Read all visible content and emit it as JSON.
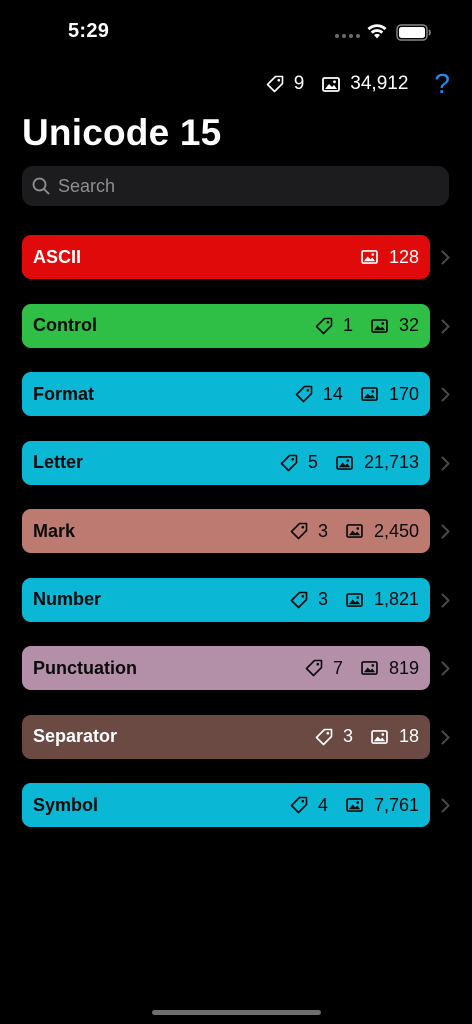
{
  "status": {
    "time": "5:29"
  },
  "header": {
    "tag_count": "9",
    "image_count": "34,912",
    "help_label": "?",
    "title": "Unicode 15"
  },
  "search": {
    "placeholder": "Search",
    "value": ""
  },
  "colors": {
    "accent": "#1d8cf8",
    "background": "#000000"
  },
  "rows": [
    {
      "label": "ASCII",
      "tags": "",
      "images": "128",
      "color": "#e10a0a",
      "text": "light"
    },
    {
      "label": "Control",
      "tags": "1",
      "images": "32",
      "color": "#2fbf47",
      "text": "dark"
    },
    {
      "label": "Format",
      "tags": "14",
      "images": "170",
      "color": "#0ab8d6",
      "text": "dark"
    },
    {
      "label": "Letter",
      "tags": "5",
      "images": "21,713",
      "color": "#0ab8d6",
      "text": "dark"
    },
    {
      "label": "Mark",
      "tags": "3",
      "images": "2,450",
      "color": "#bd7a70",
      "text": "dark"
    },
    {
      "label": "Number",
      "tags": "3",
      "images": "1,821",
      "color": "#0ab8d6",
      "text": "dark"
    },
    {
      "label": "Punctuation",
      "tags": "7",
      "images": "819",
      "color": "#b48fa8",
      "text": "dark"
    },
    {
      "label": "Separator",
      "tags": "3",
      "images": "18",
      "color": "#6a4a42",
      "text": "light"
    },
    {
      "label": "Symbol",
      "tags": "4",
      "images": "7,761",
      "color": "#0ab8d6",
      "text": "dark"
    }
  ]
}
